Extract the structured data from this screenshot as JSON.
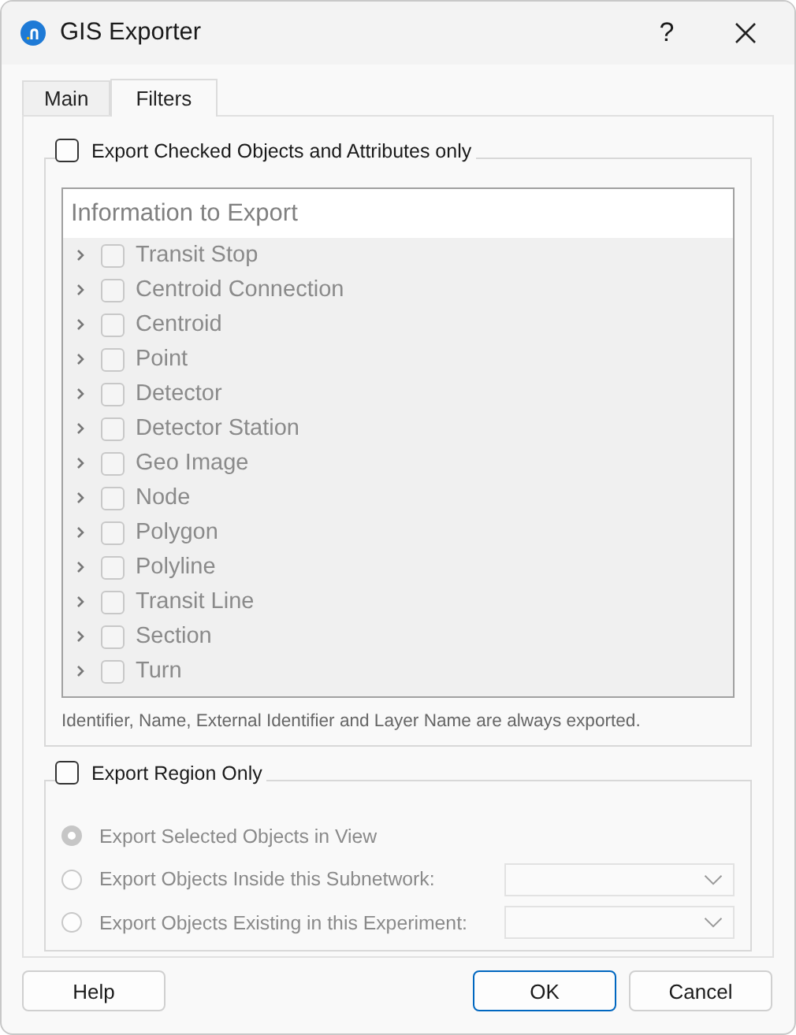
{
  "window": {
    "title": "GIS Exporter",
    "help": "?"
  },
  "tabs": [
    {
      "label": "Main",
      "selected": false
    },
    {
      "label": "Filters",
      "selected": true
    }
  ],
  "filter_group": {
    "label": "Export Checked Objects and Attributes only",
    "checked": false,
    "tree": {
      "header": "Information to Export",
      "disabled": true,
      "items": [
        {
          "label": "Transit Stop",
          "checked": false,
          "expanded": false
        },
        {
          "label": "Centroid Connection",
          "checked": false,
          "expanded": false
        },
        {
          "label": "Centroid",
          "checked": false,
          "expanded": false
        },
        {
          "label": "Point",
          "checked": false,
          "expanded": false
        },
        {
          "label": "Detector",
          "checked": false,
          "expanded": false
        },
        {
          "label": "Detector Station",
          "checked": false,
          "expanded": false
        },
        {
          "label": "Geo Image",
          "checked": false,
          "expanded": false
        },
        {
          "label": "Node",
          "checked": false,
          "expanded": false
        },
        {
          "label": "Polygon",
          "checked": false,
          "expanded": false
        },
        {
          "label": "Polyline",
          "checked": false,
          "expanded": false
        },
        {
          "label": "Transit Line",
          "checked": false,
          "expanded": false
        },
        {
          "label": "Section",
          "checked": false,
          "expanded": false
        },
        {
          "label": "Turn",
          "checked": false,
          "expanded": false
        }
      ]
    },
    "note": "Identifier, Name, External Identifier and Layer Name are always exported."
  },
  "region_group": {
    "label": "Export Region Only",
    "checked": false,
    "options": [
      {
        "kind": "plain",
        "label": "Export Selected Objects in View",
        "selected": true,
        "disabled": true
      },
      {
        "kind": "dropdown",
        "label": "Export Objects Inside this Subnetwork:",
        "selected": false,
        "disabled": true
      },
      {
        "kind": "dropdown",
        "label": "Export Objects Existing in this Experiment:",
        "selected": false,
        "disabled": true
      }
    ]
  },
  "buttons": [
    {
      "label": "Help",
      "default": false
    },
    {
      "label": "OK",
      "default": true
    },
    {
      "label": "Cancel",
      "default": false
    }
  ]
}
